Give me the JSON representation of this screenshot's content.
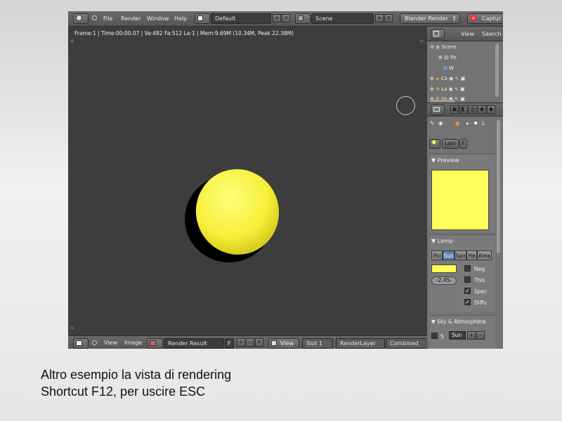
{
  "top_header": {
    "menus": [
      "File",
      "Render",
      "Window",
      "Help"
    ],
    "layout_field": "Default",
    "scene_field": "Scene",
    "engine_field": "Blender Render",
    "capture_label": "Captur"
  },
  "viewport": {
    "info": "Frame:1 | Time:00:00.07 | Ve:482 Fa:512 La:1 | Mem:9.69M (10.34M, Peak 22.38M)"
  },
  "bottom_header": {
    "view": "View",
    "image": "Image",
    "image_name": "Render Result",
    "fake_user": "F",
    "view2": "View",
    "slot": "Slot 1",
    "render_layer": "RenderLayer",
    "pass": "Combined"
  },
  "outliner": {
    "view": "View",
    "search": "Search",
    "rows": [
      "Scene",
      "Re",
      "W",
      "Ca",
      "La",
      "Sp"
    ]
  },
  "properties": {
    "lamp_tab": "L",
    "datablock": "Lam",
    "datablock_f": "F",
    "preview_title": "Preview",
    "lamp_title": "Lamp",
    "lamp_types": [
      "Poi",
      "Sun",
      "Spo",
      "He",
      "Area"
    ],
    "selected_type": "Sun",
    "energy": "2.45",
    "checkboxes": [
      {
        "label": "Neg",
        "checked": false
      },
      {
        "label": "This",
        "checked": false
      },
      {
        "label": "Spec",
        "checked": true
      },
      {
        "label": "Diffu",
        "checked": true
      }
    ],
    "sky_title": "Sky & Atmosphere",
    "sky_s": "S",
    "sky_field": "Sun"
  },
  "colors": {
    "lamp_color": "#ffff55",
    "selected_tab": "#5c7fb9"
  },
  "caption": {
    "line1": "Altro esempio la vista di rendering",
    "line2": "Shortcut F12, per uscire ESC"
  }
}
